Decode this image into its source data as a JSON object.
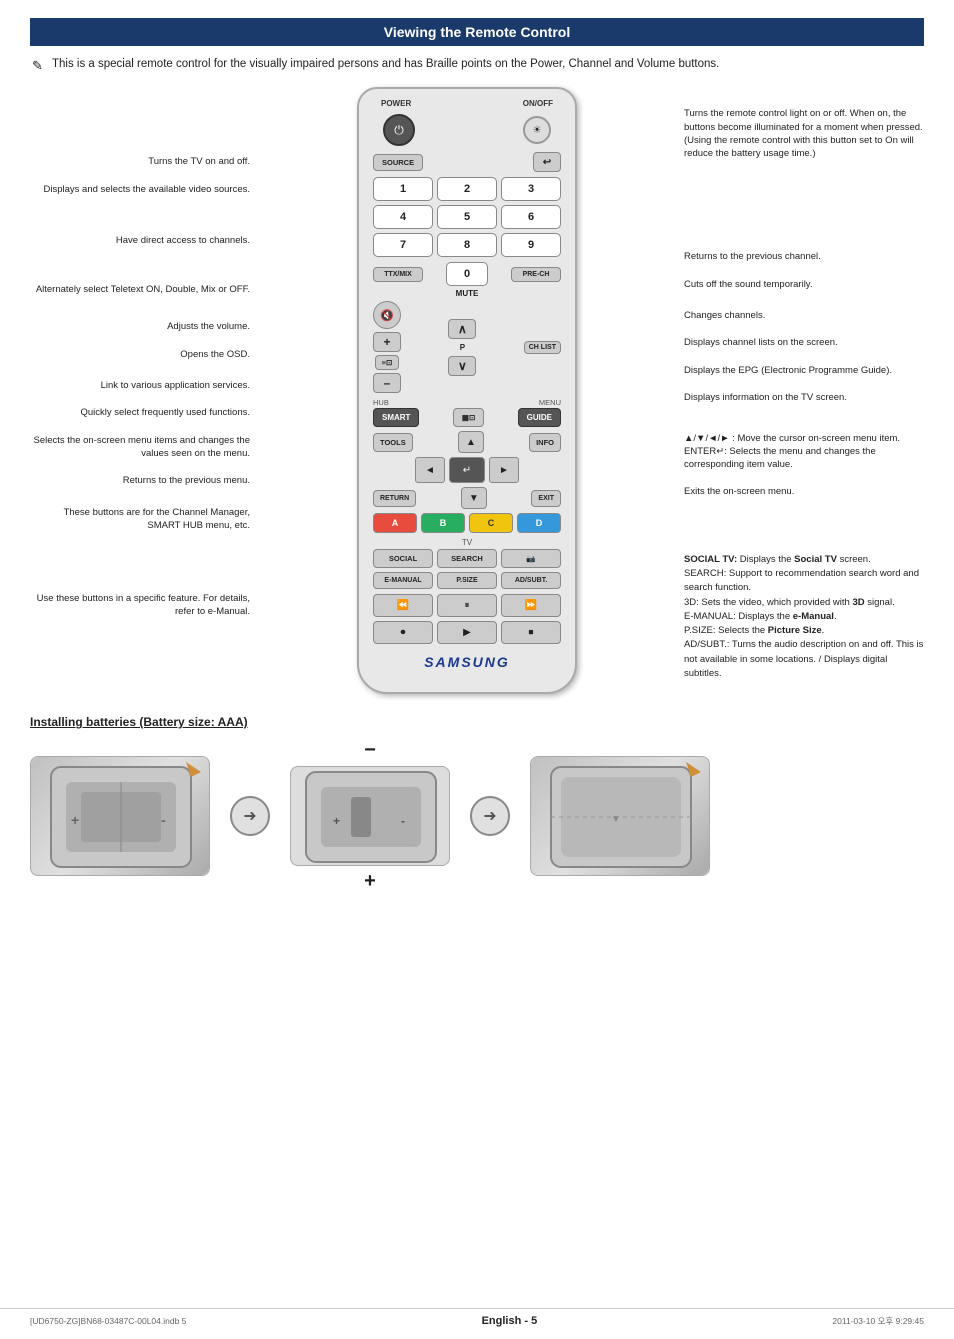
{
  "page": {
    "title": "Viewing the Remote Control",
    "intro": "This is a special remote control for the visually impaired persons and has Braille points on the Power, Channel and Volume buttons.",
    "footer_left": "[UD6750-ZG]BN68-03487C-00L04.indb   5",
    "footer_center": "English - 5",
    "footer_right": "2011-03-10   오후 9:29:45"
  },
  "remote": {
    "power_label": "POWER",
    "onoff_label": "ON/OFF",
    "source_label": "SOURCE",
    "nums": [
      "1",
      "2",
      "3",
      "4",
      "5",
      "6",
      "7",
      "8",
      "9",
      "TTX/MIX",
      "0",
      "PRE-CH"
    ],
    "mute_label": "MUTE",
    "vol_up": "+",
    "vol_down": "–",
    "ch_up": "∧",
    "ch_down": "∨",
    "ch_list": "CH LIST",
    "hub_label": "HUB",
    "menu_label": "MENU",
    "smart_label": "SMART",
    "guide_label": "GUIDE",
    "tools_label": "TOOLS",
    "info_label": "INFO",
    "return_label": "RETURN",
    "exit_label": "EXIT",
    "a_label": "A",
    "b_label": "B",
    "c_label": "C",
    "d_label": "D",
    "tv_label": "TV",
    "social_label": "SOCIAL",
    "search_label": "SEARCH",
    "emanual_label": "E-MANUAL",
    "psize_label": "P.SIZE",
    "adsubt_label": "AD/SUBT.",
    "samsung_logo": "SAMSUNG"
  },
  "annotations": {
    "left": [
      {
        "id": "ann-power",
        "text": "Turns the TV on and off."
      },
      {
        "id": "ann-source",
        "text": "Displays and selects the available video sources."
      },
      {
        "id": "ann-channels",
        "text": "Have direct access to channels."
      },
      {
        "id": "ann-ttx",
        "text": "Alternately select Teletext ON, Double, Mix or OFF."
      },
      {
        "id": "ann-vol",
        "text": "Adjusts the volume."
      },
      {
        "id": "ann-osd",
        "text": "Opens the OSD."
      },
      {
        "id": "ann-applink",
        "text": "Link to various application services."
      },
      {
        "id": "ann-tools",
        "text": "Quickly select frequently used functions."
      },
      {
        "id": "ann-menu",
        "text": "Selects the on-screen menu items and changes the values seen on the menu."
      },
      {
        "id": "ann-return",
        "text": "Returns to the previous menu."
      },
      {
        "id": "ann-abcd",
        "text": "These buttons are for the Channel Manager, SMART HUB menu, etc."
      },
      {
        "id": "ann-media",
        "text": "Use these buttons in a specific feature. For details, refer to e-Manual."
      }
    ],
    "right": [
      {
        "id": "ann-onoff",
        "text": "Turns the remote control light on or off. When on, the buttons become illuminated for a moment when pressed. (Using the remote control with this button set to On will reduce the battery usage time.)"
      },
      {
        "id": "ann-prech",
        "text": "Returns to the previous channel."
      },
      {
        "id": "ann-mute",
        "text": "Cuts off the sound temporarily."
      },
      {
        "id": "ann-chchange",
        "text": "Changes channels."
      },
      {
        "id": "ann-chlist",
        "text": "Displays channel lists on the screen."
      },
      {
        "id": "ann-epg",
        "text": "Displays the EPG (Electronic Programme Guide)."
      },
      {
        "id": "ann-info",
        "text": "Displays information on the TV screen."
      },
      {
        "id": "ann-navigate",
        "text": "▲/▼/◄/► : Move the cursor on-screen menu item.\nENTER: Selects the menu and changes the corresponding item value."
      },
      {
        "id": "ann-exit",
        "text": "Exits the on-screen menu."
      },
      {
        "id": "ann-social",
        "text": "SOCIAL TV: Displays the Social TV screen.\nSEARCH: Support to recommendation search word and search function.\n3D: Sets the video, which provided with 3D signal.\nE-MANUAL: Displays the e-Manual.\nP.SIZE: Selects the Picture Size.\nAD/SUBT.: Turns the audio description on and off. This is not available in some locations. / Displays digital subtitles."
      }
    ]
  },
  "batteries": {
    "title": "Installing batteries (Battery size: AAA)"
  }
}
